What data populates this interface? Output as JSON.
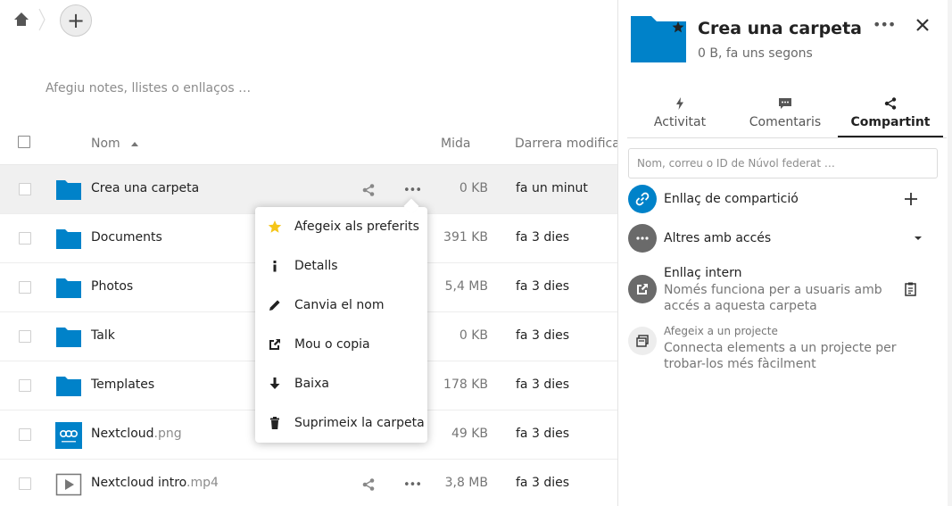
{
  "toolbar": {
    "add_label": "+"
  },
  "notes_placeholder": "Afegiu notes, llistes o enllaços …",
  "columns": {
    "name": "Nom",
    "size": "Mida",
    "modified": "Darrera modificació"
  },
  "files": [
    {
      "name": "Crea una carpeta",
      "ext": "",
      "size": "0 KB",
      "modified": "fa un minut",
      "type": "folder"
    },
    {
      "name": "Documents",
      "ext": "",
      "size": "391 KB",
      "modified": "fa 3 dies",
      "type": "folder"
    },
    {
      "name": "Photos",
      "ext": "",
      "size": "5,4 MB",
      "modified": "fa 3 dies",
      "type": "folder"
    },
    {
      "name": "Talk",
      "ext": "",
      "size": "0 KB",
      "modified": "fa 3 dies",
      "type": "folder"
    },
    {
      "name": "Templates",
      "ext": "",
      "size": "178 KB",
      "modified": "fa 3 dies",
      "type": "folder"
    },
    {
      "name": "Nextcloud",
      "ext": ".png",
      "size": "49 KB",
      "modified": "fa 3 dies",
      "type": "image"
    },
    {
      "name": "Nextcloud intro",
      "ext": ".mp4",
      "size": "3,8 MB",
      "modified": "fa 3 dies",
      "type": "video"
    }
  ],
  "context_menu": {
    "items": [
      {
        "label": "Afegeix als preferits",
        "icon": "star-icon"
      },
      {
        "label": "Detalls",
        "icon": "info-icon"
      },
      {
        "label": "Canvia el nom",
        "icon": "pencil-icon"
      },
      {
        "label": "Mou o copia",
        "icon": "external-icon"
      },
      {
        "label": "Baixa",
        "icon": "download-icon"
      },
      {
        "label": "Suprimeix la carpeta",
        "icon": "delete-icon"
      }
    ]
  },
  "sidebar": {
    "title": "Crea una carpeta",
    "subtitle": "0 B, fa uns segons",
    "tabs": [
      {
        "label": "Activitat",
        "icon": "activity-icon"
      },
      {
        "label": "Comentaris",
        "icon": "comment-icon"
      },
      {
        "label": "Compartint",
        "icon": "share-icon"
      }
    ],
    "share_placeholder": "Nom, correu o ID de Núvol federat …",
    "share_link_label": "Enllaç de compartició",
    "others_label": "Altres amb accés",
    "internal_link_label": "Enllaç intern",
    "internal_link_desc": "Només funciona per a usuaris amb accés a aquesta carpeta",
    "project_label": "Afegeix a un projecte",
    "project_desc": "Connecta elements a un projecte per trobar-los més fàcilment"
  },
  "colors": {
    "folder": "#0082c9",
    "accent": "#0082c9",
    "star": "#f5c518"
  }
}
